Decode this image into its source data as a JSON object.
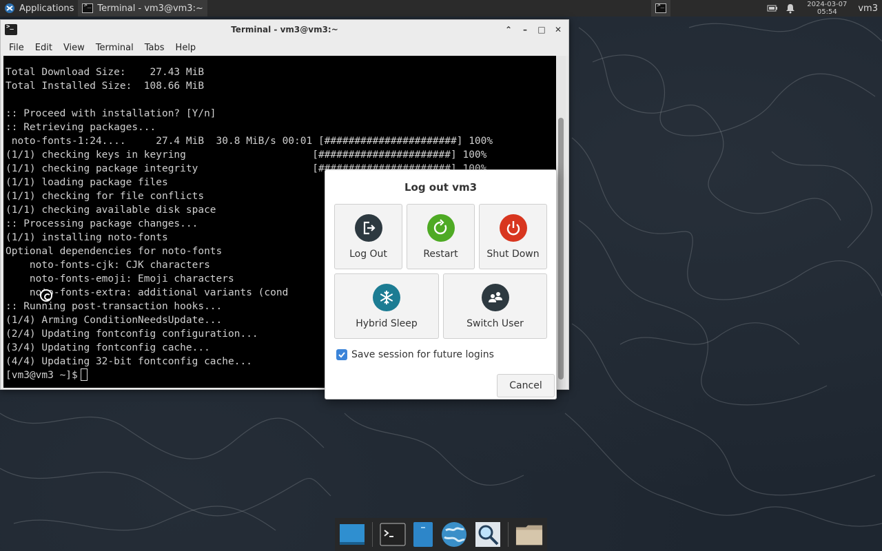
{
  "top_panel": {
    "applications_label": "Applications",
    "task_label": "Terminal - vm3@vm3:~",
    "date": "2024-03-07",
    "time": "05:54",
    "user": "vm3"
  },
  "terminal": {
    "title": "Terminal - vm3@vm3:~",
    "menu": [
      "File",
      "Edit",
      "View",
      "Terminal",
      "Tabs",
      "Help"
    ],
    "lines": [
      "Total Download Size:    27.43 MiB",
      "Total Installed Size:  108.66 MiB",
      "",
      ":: Proceed with installation? [Y/n]",
      ":: Retrieving packages...",
      " noto-fonts-1:24....     27.4 MiB  30.8 MiB/s 00:01 [######################] 100%",
      "(1/1) checking keys in keyring                     [######################] 100%",
      "(1/1) checking package integrity                   [######################] 100%",
      "(1/1) loading package files",
      "(1/1) checking for file conflicts",
      "(1/1) checking available disk space",
      ":: Processing package changes...",
      "(1/1) installing noto-fonts",
      "Optional dependencies for noto-fonts",
      "    noto-fonts-cjk: CJK characters",
      "    noto-fonts-emoji: Emoji characters",
      "    noto-fonts-extra: additional variants (cond",
      ":: Running post-transaction hooks...",
      "(1/4) Arming ConditionNeedsUpdate...",
      "(2/4) Updating fontconfig configuration...",
      "(3/4) Updating fontconfig cache...",
      "(4/4) Updating 32-bit fontconfig cache..."
    ],
    "prompt": "[vm3@vm3 ~]$ "
  },
  "dialog": {
    "title": "Log out vm3",
    "log_out": "Log Out",
    "restart": "Restart",
    "shut_down": "Shut Down",
    "hybrid_sleep": "Hybrid Sleep",
    "switch_user": "Switch User",
    "save_session": "Save session for future logins",
    "save_session_checked": true,
    "cancel": "Cancel"
  }
}
